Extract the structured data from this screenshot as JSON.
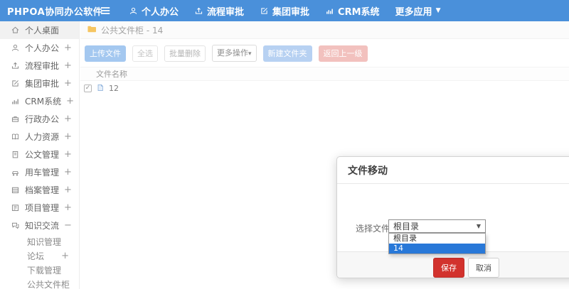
{
  "topbar": {
    "logo": "PHPOA协同办公软件",
    "nav": [
      {
        "label": "个人办公",
        "icon": "user-icon"
      },
      {
        "label": "流程审批",
        "icon": "upload-icon"
      },
      {
        "label": "集团审批",
        "icon": "edit-icon"
      },
      {
        "label": "CRM系统",
        "icon": "chart-icon"
      },
      {
        "label": "更多应用",
        "icon": "caret-down-icon"
      }
    ]
  },
  "sidebar": {
    "items": [
      {
        "label": "个人桌面",
        "icon": "home-icon",
        "active": true
      },
      {
        "label": "个人办公",
        "icon": "user-icon",
        "expand": "+"
      },
      {
        "label": "流程审批",
        "icon": "upload-icon",
        "expand": "+"
      },
      {
        "label": "集团审批",
        "icon": "edit-icon",
        "expand": "+"
      },
      {
        "label": "CRM系统",
        "icon": "chart-icon",
        "expand": "+"
      },
      {
        "label": "行政办公",
        "icon": "briefcase-icon",
        "expand": "+"
      },
      {
        "label": "人力资源",
        "icon": "book-icon",
        "expand": "+"
      },
      {
        "label": "公文管理",
        "icon": "document-icon",
        "expand": "+"
      },
      {
        "label": "用车管理",
        "icon": "car-icon",
        "expand": "+"
      },
      {
        "label": "档案管理",
        "icon": "archive-icon",
        "expand": "+"
      },
      {
        "label": "项目管理",
        "icon": "project-icon",
        "expand": "+"
      },
      {
        "label": "知识交流",
        "icon": "chat-icon",
        "expand": "−",
        "open": true
      }
    ],
    "subitems": [
      {
        "label": "知识管理",
        "expand": ""
      },
      {
        "label": "论坛",
        "expand": "+"
      },
      {
        "label": "下载管理",
        "expand": ""
      },
      {
        "label": "公共文件柜",
        "expand": ""
      }
    ]
  },
  "breadcrumb": {
    "icon": "folder-icon",
    "text": "公共文件柜 - 14"
  },
  "toolbar": {
    "upload": "上传文件",
    "select_all": "全选",
    "batch_delete": "批量删除",
    "more_actions": "更多操作",
    "more_caret": "▾",
    "new_folder": "新建文件夹",
    "go_back": "返回上一级"
  },
  "file_table": {
    "header": "文件名称",
    "rows": [
      {
        "name": "12",
        "checked": true,
        "check_glyph": "✓",
        "icon": "file-icon"
      }
    ]
  },
  "modal": {
    "title": "文件移动",
    "field_label": "选择文件夹",
    "select_value": "根目录",
    "select_caret": "▼",
    "options": [
      {
        "label": "根目录",
        "selected": false
      },
      {
        "label": "14",
        "selected": true
      }
    ],
    "save_label": "保存",
    "cancel_label": "取消"
  },
  "colors": {
    "topbar_blue": "#4a90da",
    "upload_btn_blue": "#a4c8f0",
    "new_folder_blue": "#b7d1f2",
    "back_btn_pink": "#f2c1be",
    "save_red": "#d2322d",
    "option_highlight_blue": "#2878d8",
    "folder_icon_yellow": "#f6c561"
  }
}
